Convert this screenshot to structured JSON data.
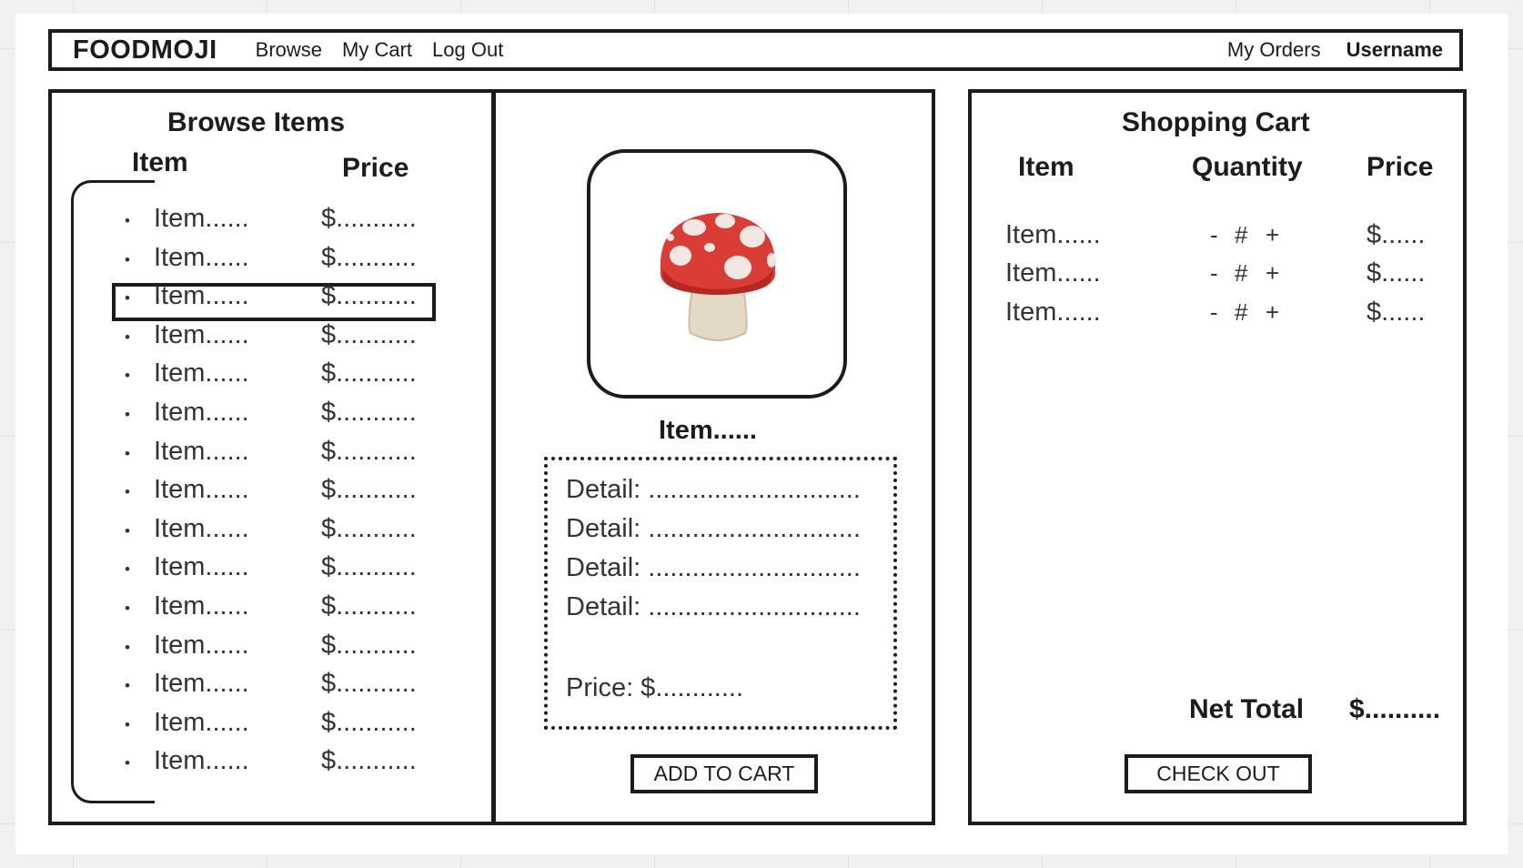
{
  "nav": {
    "brand": "FOODMOJI",
    "links": [
      "Browse",
      "My Cart",
      "Log Out"
    ],
    "my_orders": "My Orders",
    "username": "Username"
  },
  "browse": {
    "title": "Browse Items",
    "col_item": "Item",
    "col_price": "Price",
    "bullet": "•",
    "items": [
      {
        "name": "Item......",
        "price": "$..........."
      },
      {
        "name": "Item......",
        "price": "$..........."
      },
      {
        "name": "Item......",
        "price": "$..........."
      },
      {
        "name": "Item......",
        "price": "$..........."
      },
      {
        "name": "Item......",
        "price": "$..........."
      },
      {
        "name": "Item......",
        "price": "$..........."
      },
      {
        "name": "Item......",
        "price": "$..........."
      },
      {
        "name": "Item......",
        "price": "$..........."
      },
      {
        "name": "Item......",
        "price": "$..........."
      },
      {
        "name": "Item......",
        "price": "$..........."
      },
      {
        "name": "Item......",
        "price": "$..........."
      },
      {
        "name": "Item......",
        "price": "$..........."
      },
      {
        "name": "Item......",
        "price": "$..........."
      },
      {
        "name": "Item......",
        "price": "$..........."
      },
      {
        "name": "Item......",
        "price": "$..........."
      }
    ],
    "selected_index": 2
  },
  "detail": {
    "image_icon": "mushroom-emoji",
    "item_name": "Item......",
    "details": [
      "Detail: .............................",
      "Detail: .............................",
      "Detail: .............................",
      "Detail: ............................."
    ],
    "price": "Price: $............",
    "add_button": "ADD TO CART"
  },
  "cart": {
    "title": "Shopping Cart",
    "col_item": "Item",
    "col_quantity": "Quantity",
    "col_price": "Price",
    "rows": [
      {
        "item": "Item......",
        "minus": "-",
        "qty": "#",
        "plus": "+",
        "price": "$......"
      },
      {
        "item": "Item......",
        "minus": "-",
        "qty": "#",
        "plus": "+",
        "price": "$......"
      },
      {
        "item": "Item......",
        "minus": "-",
        "qty": "#",
        "plus": "+",
        "price": "$......"
      }
    ],
    "net_total_label": "Net Total",
    "net_total_value": "$..........",
    "checkout_button": "CHECK OUT"
  }
}
